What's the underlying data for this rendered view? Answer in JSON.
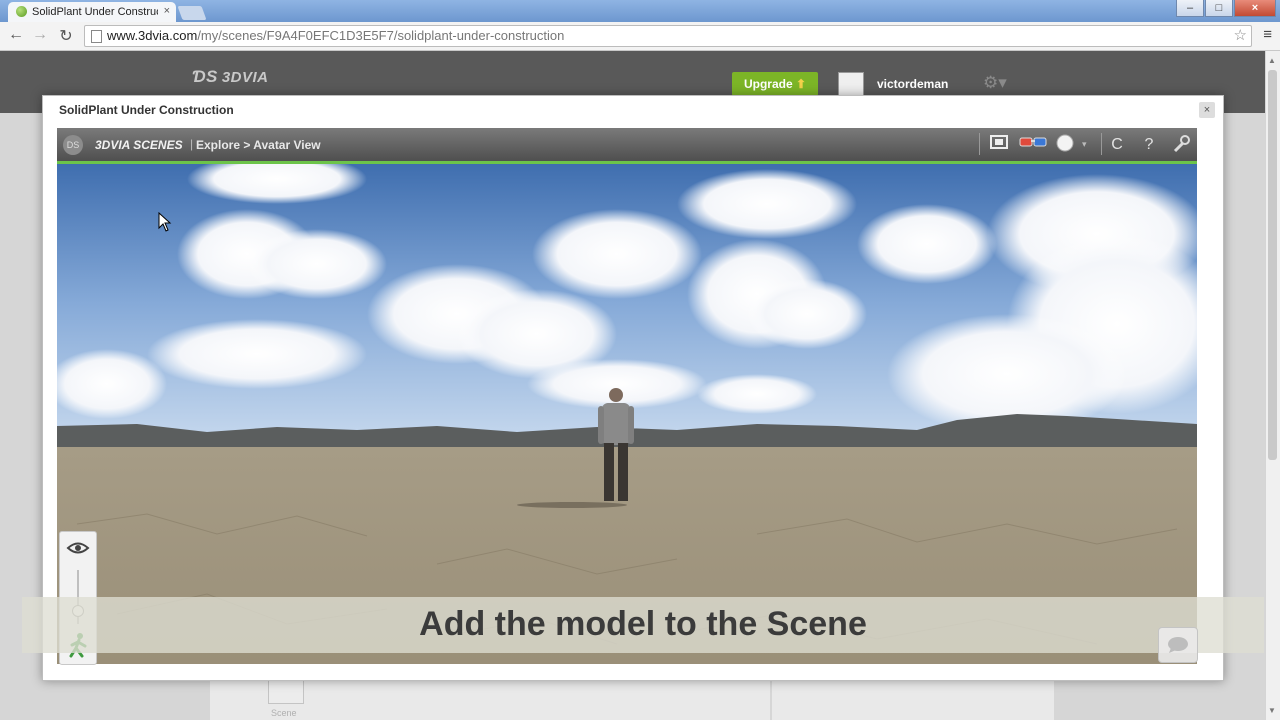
{
  "browser": {
    "tab_title": "SolidPlant Under Constructi",
    "tab_close": "×",
    "url_host": "www.3dvia.com",
    "url_path": "/my/scenes/F9A4F0EFC1D3E5F7/solidplant-under-construction"
  },
  "site": {
    "logo": "3DVIA",
    "upgrade_label": "Upgrade",
    "username": "victordeman",
    "scene_card_label": "Scene"
  },
  "modal": {
    "title": "SolidPlant Under Construction",
    "close": "×"
  },
  "viewer": {
    "brand": "3DVIA SCENES",
    "separator": "|",
    "breadcrumb": "Explore > Avatar View",
    "tool_icons": [
      "fullscreen-icon",
      "anaglyph-3d-icon",
      "quality-icon",
      "reset-icon",
      "help-icon",
      "settings-wrench-icon"
    ]
  },
  "caption": {
    "text": "Add the model to the Scene"
  },
  "colors": {
    "accent_green": "#6cc44a",
    "upgrade_green": "#7cb527",
    "header_gray": "#595959"
  }
}
